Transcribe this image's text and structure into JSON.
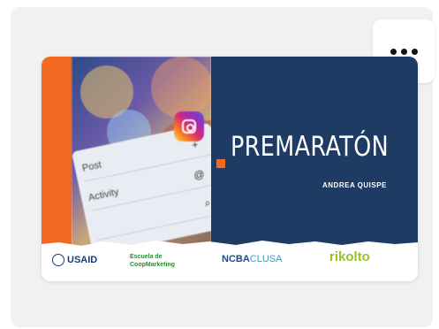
{
  "card": {
    "menu_label": "More options",
    "thumbnail": {
      "title": "PREMARATÓN",
      "author": "ANDREA QUISPE",
      "photo_rows": [
        "Post",
        "Activity",
        ""
      ],
      "logos": {
        "usaid": "USAID",
        "usaid_sub": "",
        "escuela": [
          "Escuela de",
          "CoopMarketing"
        ],
        "ncba_bold": "NCBA",
        "ncba_light": "CLUSA",
        "rikolto": "rikolto",
        "rikolto_sub": ""
      }
    }
  },
  "colors": {
    "accent_orange": "#f26a21",
    "navy": "#1d3b63",
    "card_bg": "#f0f1f3"
  },
  "icons": [
    "more-horizontal-icon",
    "instagram-icon",
    "plus-icon",
    "threads-icon",
    "search-icon"
  ]
}
